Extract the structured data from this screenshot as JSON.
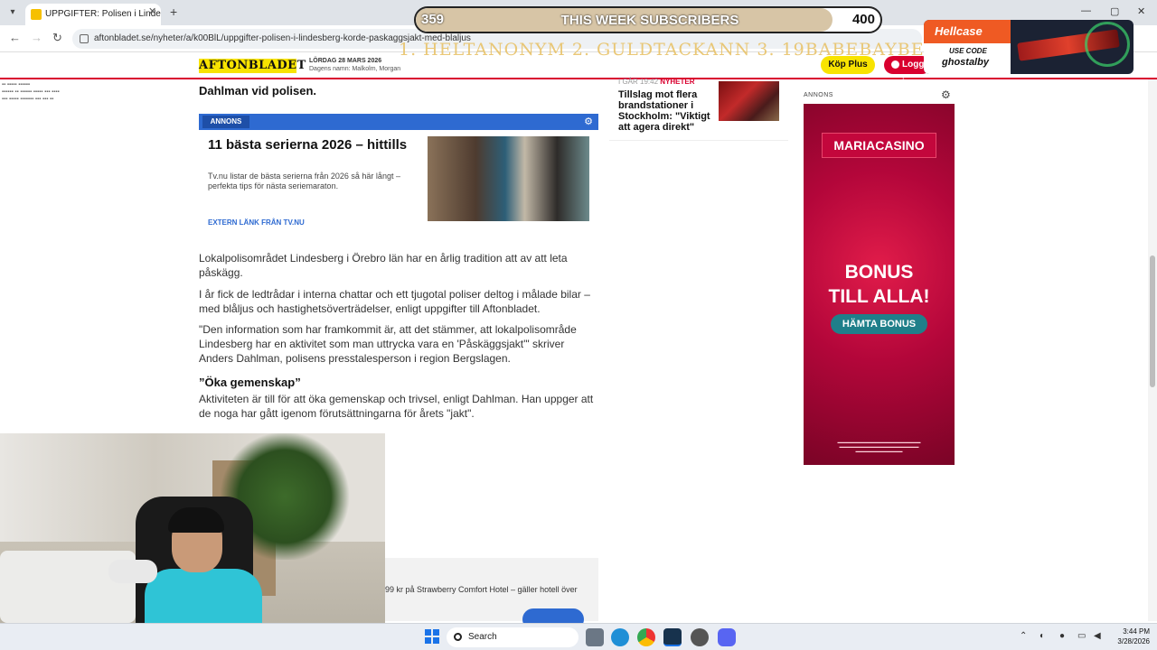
{
  "browser": {
    "tab_title": "UPPGIFTER: Polisen i Lindesberg",
    "url": "aftonbladet.se/nyheter/a/k00BlL/uppgifter-polisen-i-lindesberg-korde-paskaggsjakt-med-blaljus"
  },
  "site_header": {
    "logo": "AFTONBLADET",
    "date": "LÖRDAG 28 MARS 2026",
    "names": "Dagens namn: Malkolm, Morgan",
    "buy_plus": "Köp Plus",
    "login": "Logga in"
  },
  "article": {
    "intro_tail": "Dahlman vid polisen.",
    "ad": {
      "label": "ANNONS",
      "title": "11 bästa serierna 2026 – hittills",
      "desc": "Tv.nu listar de bästa serierna från 2026 så här långt – perfekta tips för nästa seriemaraton.",
      "link": "EXTERN LÄNK FRÅN TV.NU"
    },
    "p1": "Lokalpolisområdet Lindesberg i Örebro län har en årlig tradition att av att leta påskägg.",
    "p2": "I år fick de ledtrådar i interna chattar och ett tjugotal poliser deltog i målade bilar – med blåljus och hastighetsöverträdelser, enligt uppgifter till Aftonbladet.",
    "p3": "\"Den information som har framkommit är, att det stämmer, att lokalpolisområde Lindesberg har en aktivitet som man uttrycka vara en 'Påskäggsjakt'\" skriver Anders Dahlman, polisens presstalesperson i region Bergslagen.",
    "subhead": "”Öka gemenskap”",
    "p4": "Aktiviteten är till för att öka gemenskap och trivsel, enligt Dahlman. Han uppger att de noga har gått igenom förutsättningarna för årets \"jakt\".",
    "sponsored": "99 kr på Strawberry Comfort Hotel – gäller hotell över"
  },
  "sidebar": {
    "news_meta": "I GÅR 19:42",
    "news_tag": "NYHETER",
    "news_title": "Tillslag mot flera brandstationer i Stockholm: \"Viktigt att agera direkt\"",
    "annons": "ANNONS",
    "casino": {
      "logo": "MARIACASINO",
      "bonus_line1": "BONUS",
      "bonus_line2": "TILL ALLA!",
      "button": "HÄMTA BONUS"
    }
  },
  "overlay": {
    "sub_left": "359",
    "sub_title": "THIS WEEK SUBSCRIBERS",
    "sub_right": "400",
    "sub_progress": 0.8975,
    "leaders": "1. HELTANONYM  2. GULDTACKANN  3. 19BABEBAYBE",
    "hellcase_logo": "Hellcase",
    "hellcase_code_label": "USE CODE",
    "hellcase_code": "ghostalby"
  },
  "taskbar": {
    "search": "Search",
    "time": "3:44 PM",
    "date": "3/28/2026"
  }
}
